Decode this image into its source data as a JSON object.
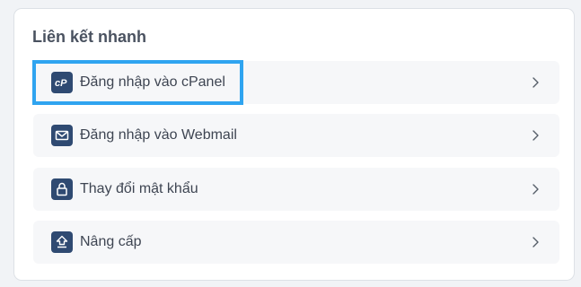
{
  "quick_links": {
    "title": "Liên kết nhanh",
    "items": [
      {
        "label": "Đăng nhập vào cPanel",
        "icon": "cpanel-icon",
        "highlighted": true
      },
      {
        "label": "Đăng nhập vào Webmail",
        "icon": "envelope-icon",
        "highlighted": false
      },
      {
        "label": "Thay đổi mật khẩu",
        "icon": "lock-icon",
        "highlighted": false
      },
      {
        "label": "Nâng cấp",
        "icon": "upload-icon",
        "highlighted": false
      }
    ]
  },
  "colors": {
    "icon_bg": "#2f4a72",
    "highlight_border": "#2fa4f0",
    "chevron": "#555d68"
  }
}
